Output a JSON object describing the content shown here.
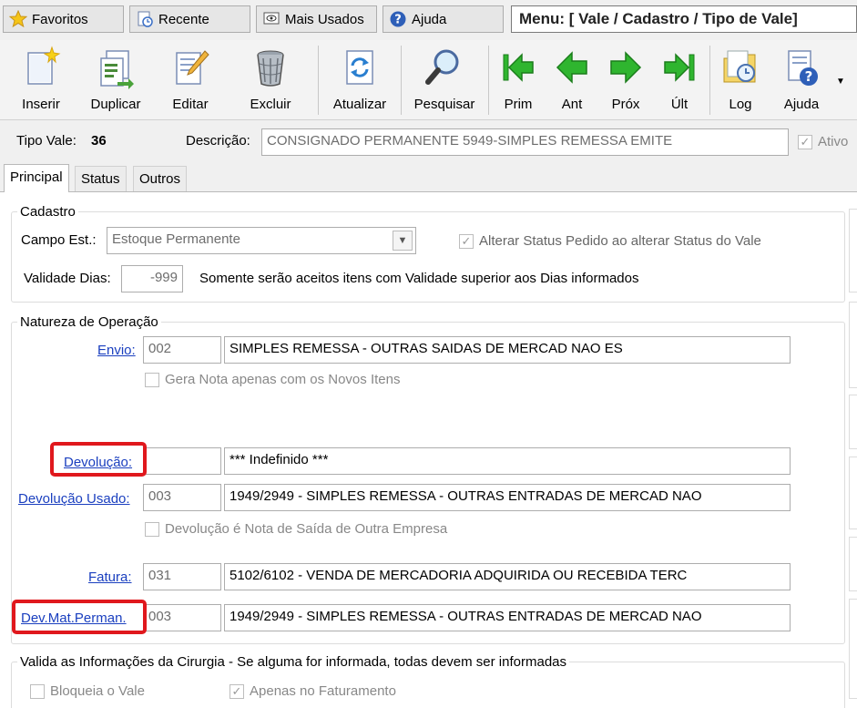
{
  "topbar": {
    "favoritos": "Favoritos",
    "recente": "Recente",
    "mais_usados": "Mais Usados",
    "ajuda": "Ajuda",
    "menu_title": "Menu: [ Vale / Cadastro / Tipo de Vale]"
  },
  "toolbar": {
    "inserir": "Inserir",
    "duplicar": "Duplicar",
    "editar": "Editar",
    "excluir": "Excluir",
    "atualizar": "Atualizar",
    "pesquisar": "Pesquisar",
    "prim": "Prim",
    "ant": "Ant",
    "prox": "Próx",
    "ult": "Últ",
    "log": "Log",
    "ajuda": "Ajuda"
  },
  "header": {
    "tipo_vale_label": "Tipo Vale:",
    "tipo_vale_value": "36",
    "descricao_label": "Descrição:",
    "descricao_value": "CONSIGNADO PERMANENTE 5949-SIMPLES REMESSA EMITE",
    "ativo_label": "Ativo"
  },
  "tabs": [
    "Principal",
    "Status",
    "Outros"
  ],
  "cadastro": {
    "legend": "Cadastro",
    "campo_est_label": "Campo Est.:",
    "campo_est_value": "Estoque Permanente",
    "alterar_status_label": "Alterar Status Pedido ao alterar Status do Vale",
    "validade_label": "Validade Dias:",
    "validade_value": "-999",
    "validade_note": "Somente serão aceitos itens com Validade superior aos Dias informados"
  },
  "natureza": {
    "legend": "Natureza de Operação",
    "envio": {
      "label": "Envio:",
      "code": "002",
      "desc": "SIMPLES REMESSA - OUTRAS SAIDAS DE MERCAD NAO ES"
    },
    "gera_nota_label": "Gera Nota apenas com os Novos Itens",
    "devolucao": {
      "label": "Devolução:",
      "code": "",
      "desc": "*** Indefinido ***"
    },
    "devolucao_usado": {
      "label": "Devolução Usado:",
      "code": "003",
      "desc": "1949/2949 - SIMPLES REMESSA - OUTRAS ENTRADAS DE MERCAD NAO"
    },
    "devolucao_nota_label": "Devolução é Nota de Saída de Outra Empresa",
    "fatura": {
      "label": "Fatura:",
      "code": "031",
      "desc": "5102/6102 - VENDA DE MERCADORIA ADQUIRIDA OU RECEBIDA TERC"
    },
    "dev_mat_perman": {
      "label": "Dev.Mat.Perman.",
      "code": "003",
      "desc": "1949/2949 - SIMPLES REMESSA - OUTRAS ENTRADAS DE MERCAD NAO"
    }
  },
  "cirurgia": {
    "legend": "Valida as Informações da Cirurgia - Se alguma for informada, todas devem ser informadas",
    "bloqueia_label": "Bloqueia o Vale",
    "apenas_fat_label": "Apenas no Faturamento"
  },
  "colors": {
    "link": "#1a3fbf",
    "highlight": "#e0181d",
    "nav_green": "#2fb52f"
  }
}
